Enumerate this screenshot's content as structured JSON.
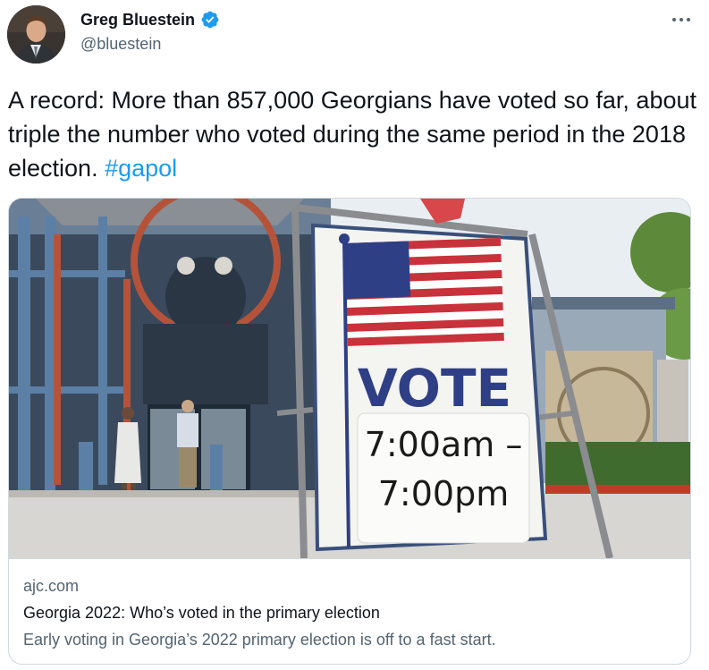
{
  "author": {
    "name": "Greg Bluestein",
    "handle": "@bluestein",
    "verified": true,
    "avatar_icon": "avatar-photo"
  },
  "more_icon": "more-horizontal-icon",
  "tweet": {
    "text": "A record: More than 857,000 Georgians have voted so far, about triple the number who voted during the same period in the 2018 election.",
    "hashtag": "#gapol"
  },
  "card": {
    "image": {
      "description_icon": "vote-sign-photo",
      "sign_word": "VOTE",
      "sign_time_start": "7:00am –",
      "sign_time_end": "7:00pm"
    },
    "domain": "ajc.com",
    "title": "Georgia 2022: Who’s voted in the primary election",
    "description": "Early voting in Georgia’s 2022 primary election is off to a fast start."
  },
  "colors": {
    "link": "#1d9bf0",
    "text": "#0f1419",
    "secondary": "#536471",
    "border": "#cfd9de"
  }
}
